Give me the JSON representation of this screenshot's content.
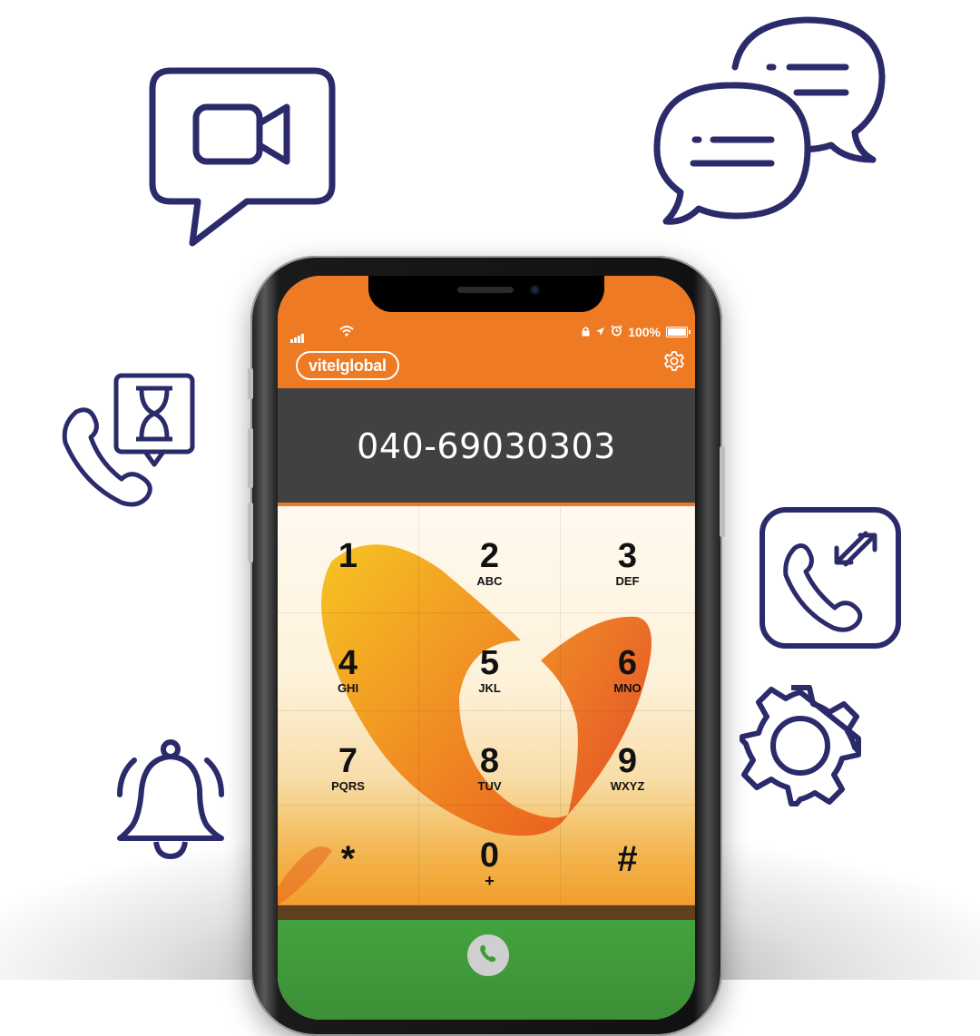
{
  "status_bar": {
    "battery_text": "100%",
    "icons": [
      "signal-icon",
      "wifi-icon",
      "lock-icon",
      "location-arrow-icon",
      "alarm-icon",
      "battery-icon"
    ]
  },
  "header": {
    "logo_text": "vitelglobal",
    "settings_icon": "gear-icon"
  },
  "display": {
    "number": "040-69030303"
  },
  "keypad": [
    {
      "digit": "1",
      "letters": ""
    },
    {
      "digit": "2",
      "letters": "ABC"
    },
    {
      "digit": "3",
      "letters": "DEF"
    },
    {
      "digit": "4",
      "letters": "GHI"
    },
    {
      "digit": "5",
      "letters": "JKL"
    },
    {
      "digit": "6",
      "letters": "MNO"
    },
    {
      "digit": "7",
      "letters": "PQRS"
    },
    {
      "digit": "8",
      "letters": "TUV"
    },
    {
      "digit": "9",
      "letters": "WXYZ"
    },
    {
      "digit": "*",
      "letters": ""
    },
    {
      "digit": "0",
      "letters": "+"
    },
    {
      "digit": "#",
      "letters": ""
    }
  ],
  "call": {
    "icon": "phone-icon"
  },
  "decor_icons": [
    "video-chat-icon",
    "chat-bubbles-icon",
    "call-waiting-icon",
    "call-transfer-icon",
    "bell-icon",
    "gear-icon"
  ],
  "colors": {
    "brand_orange": "#ee7a23",
    "dark_bar": "#414141",
    "call_green": "#43a33e",
    "icon_navy": "#2b2a6b"
  }
}
